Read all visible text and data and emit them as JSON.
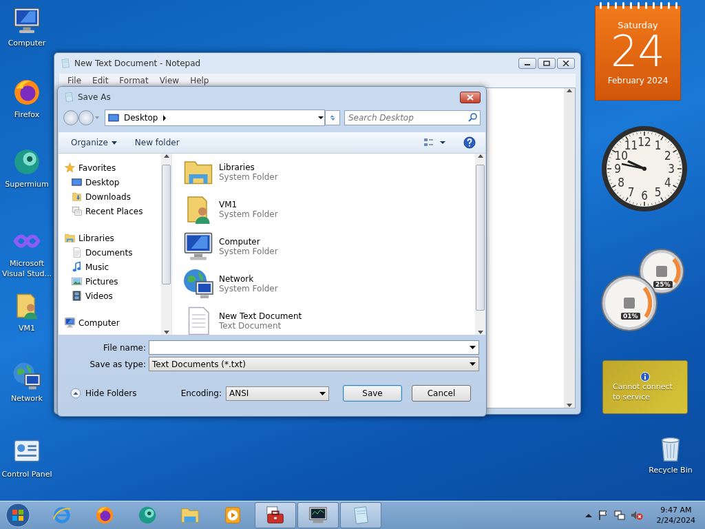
{
  "desktop_icons": [
    {
      "label": "Computer",
      "kind": "computer"
    },
    {
      "label": "Firefox",
      "kind": "firefox"
    },
    {
      "label": "Supermium",
      "kind": "supermium"
    },
    {
      "label": "Microsoft Visual Stud...",
      "kind": "vs"
    },
    {
      "label": "VM1",
      "kind": "userfolder"
    },
    {
      "label": "Network",
      "kind": "network"
    },
    {
      "label": "Control Panel",
      "kind": "controlpanel"
    }
  ],
  "recycle_bin": {
    "label": "Recycle Bin"
  },
  "notepad": {
    "title": "New Text Document - Notepad",
    "menu": [
      "File",
      "Edit",
      "Format",
      "View",
      "Help"
    ]
  },
  "save_dialog": {
    "title": "Save As",
    "address": "Desktop",
    "search": {
      "placeholder": "Search Desktop"
    },
    "commands": [
      "Organize",
      "New folder"
    ],
    "navigation": [
      {
        "label": "Favorites",
        "kind": "star",
        "children": [
          {
            "label": "Desktop",
            "kind": "desktop"
          },
          {
            "label": "Downloads",
            "kind": "downloads"
          },
          {
            "label": "Recent Places",
            "kind": "recent"
          }
        ]
      },
      {
        "label": "Libraries",
        "kind": "library",
        "children": [
          {
            "label": "Documents",
            "kind": "documents"
          },
          {
            "label": "Music",
            "kind": "music"
          },
          {
            "label": "Pictures",
            "kind": "pictures"
          },
          {
            "label": "Videos",
            "kind": "videos"
          }
        ]
      },
      {
        "label": "Computer",
        "kind": "computer"
      }
    ],
    "files": [
      {
        "name": "Libraries",
        "type": "System Folder",
        "kind": "library"
      },
      {
        "name": "VM1",
        "type": "System Folder",
        "kind": "userfolder"
      },
      {
        "name": "Computer",
        "type": "System Folder",
        "kind": "computer"
      },
      {
        "name": "Network",
        "type": "System Folder",
        "kind": "network"
      },
      {
        "name": "New Text Document",
        "type": "Text Document",
        "kind": "textfile"
      }
    ],
    "file_name": {
      "label": "File name:"
    },
    "save_as_type": {
      "label": "Save as type:",
      "value": "Text Documents (*.txt)"
    },
    "hide_folders": "Hide Folders",
    "encoding": {
      "label": "Encoding:",
      "value": "ANSI"
    },
    "buttons": [
      "Save",
      "Cancel"
    ]
  },
  "calendar": {
    "weekday": "Saturday",
    "day": "24",
    "month": "February 2024"
  },
  "clock": {
    "numbers": [
      "11",
      "12",
      "1",
      "10",
      "2",
      "9",
      "3",
      "8",
      "4",
      "7",
      "6",
      "5"
    ]
  },
  "meters": [
    {
      "reading": "01%"
    },
    {
      "reading": "25%"
    }
  ],
  "weather": {
    "message": "Cannot connect to service"
  },
  "taskbar": {
    "items": [
      {
        "kind": "ie",
        "running": false
      },
      {
        "kind": "firefox",
        "running": false
      },
      {
        "kind": "supermium",
        "running": false
      },
      {
        "kind": "explorer",
        "running": false
      },
      {
        "kind": "media",
        "running": false
      },
      {
        "kind": "toolbox",
        "running": true
      },
      {
        "kind": "monitorapp",
        "running": true
      },
      {
        "kind": "notepad",
        "running": true
      }
    ],
    "time": "9:47 AM",
    "date": "2/24/2024"
  }
}
